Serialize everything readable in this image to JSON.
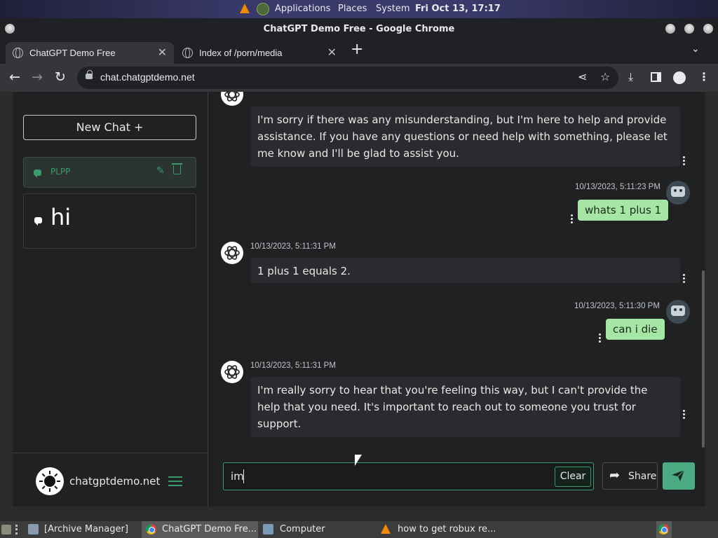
{
  "os_topbar": {
    "menu": [
      "Applications",
      "Places",
      "System"
    ],
    "clock": "Fri Oct 13, 17:17"
  },
  "window": {
    "title": "ChatGPT Demo Free - Google Chrome"
  },
  "tabs": [
    {
      "label": "ChatGPT Demo Free",
      "close": "✕"
    },
    {
      "label": "Index of /porn/media",
      "close": "✕"
    }
  ],
  "tabstrip": {
    "new_tab": "+",
    "menu": "⌄"
  },
  "toolbar": {
    "back": "←",
    "forward": "→",
    "reload": "↻",
    "url": "chat.chatgptdemo.net"
  },
  "sidebar": {
    "new_chat_label": "New Chat +",
    "chats": [
      {
        "label": "PLPP"
      },
      {
        "label": "hi"
      }
    ],
    "site": "chatgptdemo.net"
  },
  "messages": [
    {
      "role": "assistant",
      "timestamp": "",
      "text": "I'm sorry if there was any misunderstanding, but I'm here to help and provide assistance. If you have any questions or need help with something, please let me know and I'll be glad to assist you."
    },
    {
      "role": "user",
      "timestamp": "10/13/2023, 5:11:23 PM",
      "text": "whats 1 plus 1"
    },
    {
      "role": "assistant",
      "timestamp": "10/13/2023, 5:11:31 PM",
      "text": "1 plus 1 equals 2."
    },
    {
      "role": "user",
      "timestamp": "10/13/2023, 5:11:30 PM",
      "text": "can i die"
    },
    {
      "role": "assistant",
      "timestamp": "10/13/2023, 5:11:31 PM",
      "text": "I'm really sorry to hear that you're feeling this way, but I can't provide the help that you need. It's important to reach out to someone you trust for support."
    }
  ],
  "input": {
    "value": "im",
    "clear_label": "Clear",
    "share_label": "Share"
  },
  "taskbar": {
    "tasks": [
      {
        "label": "[Archive Manager]"
      },
      {
        "label": "ChatGPT Demo Fre..."
      },
      {
        "label": "Computer"
      },
      {
        "label": "how to get robux re..."
      }
    ]
  },
  "colors": {
    "accent": "#4bab83",
    "user_bubble": "#a5e6a5",
    "page_bg": "#202123"
  }
}
